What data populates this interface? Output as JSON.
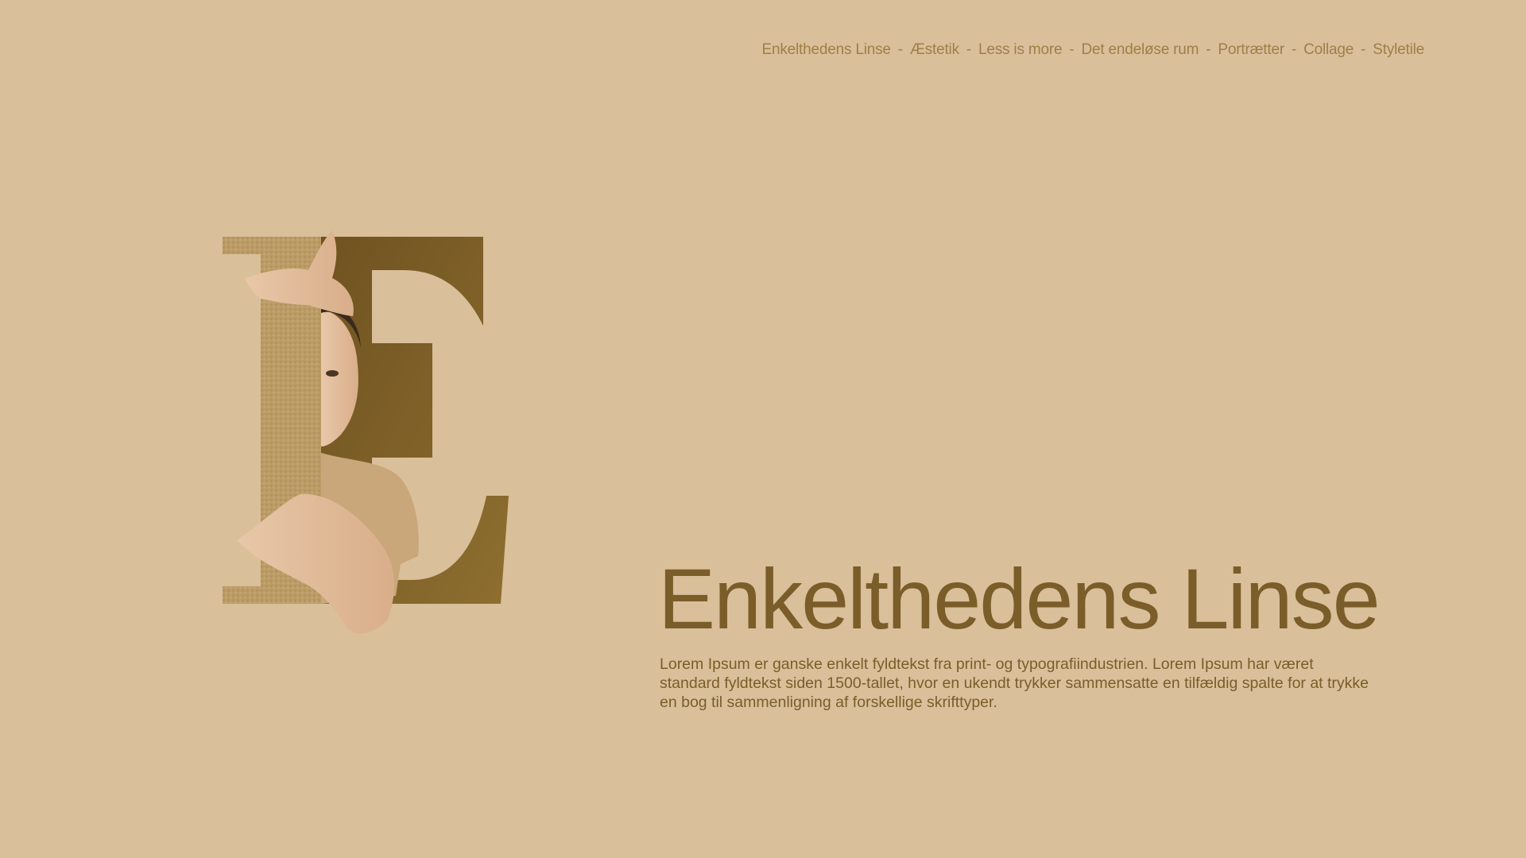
{
  "nav": {
    "items": [
      "Enkelthedens Linse",
      "Æstetik",
      "Less is more",
      "Det endeløse rum",
      "Portrætter",
      "Collage",
      "Styletile"
    ],
    "separator": "-"
  },
  "hero": {
    "title": "Enkelthedens Linse",
    "body": "Lorem Ipsum er ganske enkelt fyldtekst fra print- og typografiindustrien. Lorem Ipsum har været standard fyldtekst siden 1500-tallet, hvor en ukendt trykker sammensatte en tilfældig spalte for at trykke en bog til sammenligning af forskellige skrifttyper."
  },
  "colors": {
    "background": "#d9c09b",
    "nav_text": "#a07e47",
    "title_text": "#7a5d28",
    "letter_fill": "#7f6128"
  },
  "illustration": {
    "letter": "E"
  }
}
